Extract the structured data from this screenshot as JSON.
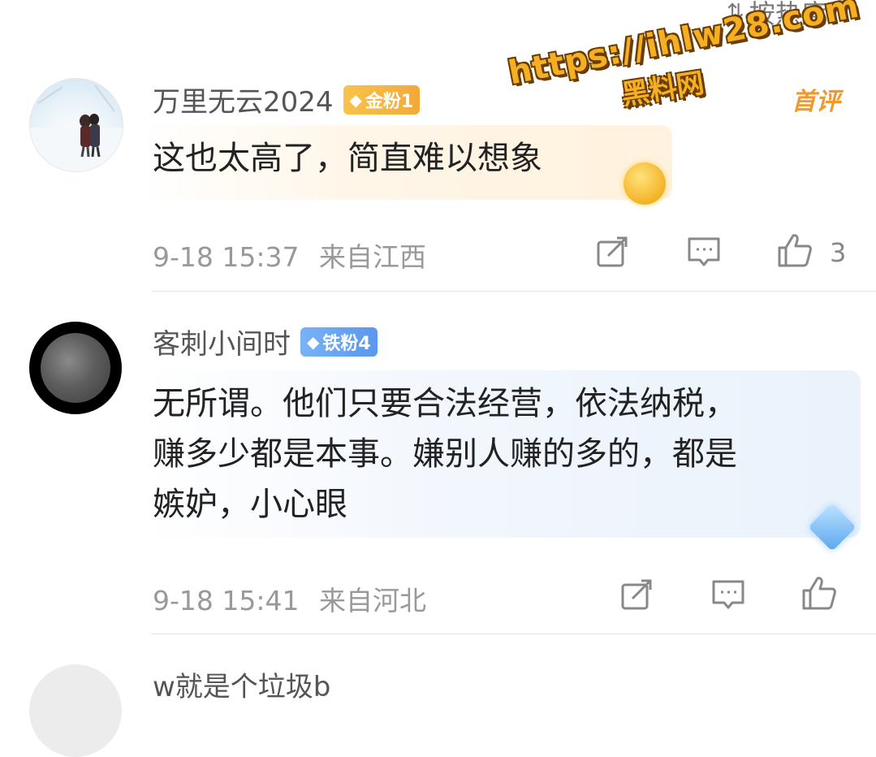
{
  "sort": {
    "label": "按热度",
    "icon": "sort-icon"
  },
  "watermark": {
    "url": "https://ihlw28.com",
    "site": "黑料网"
  },
  "comments": [
    {
      "username": "万里无云2024",
      "badge": "金粉1",
      "badge_color": "#f5b53c",
      "tag": "首评",
      "text": "这也太高了，简直难以想象",
      "time": "9-18 15:37",
      "location": "来自江西",
      "likes": "3"
    },
    {
      "username": "客刺小间时",
      "badge": "铁粉4",
      "badge_color": "#6aa5f2",
      "text_lines": [
        "无所谓。他们只要合法经营，依法纳税，",
        "赚多少都是本事。嫌别人赚的多的，都是",
        "嫉妒，小心眼"
      ],
      "time": "9-18 15:41",
      "location": "来自河北",
      "likes": ""
    },
    {
      "username": "w就是个垃圾b"
    }
  ]
}
